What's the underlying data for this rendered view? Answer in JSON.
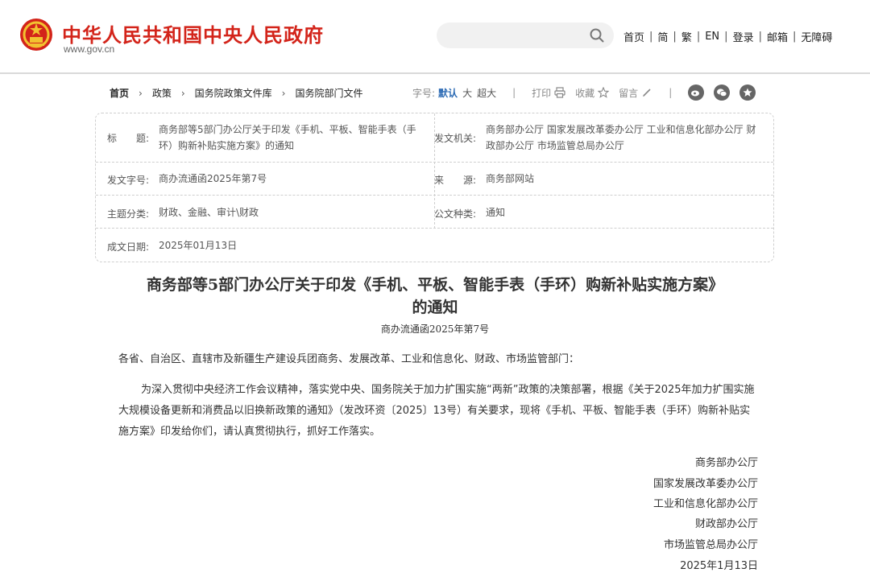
{
  "header": {
    "site_name": "中华人民共和国中央人民政府",
    "site_url": "www.gov.cn",
    "search": {
      "placeholder": ""
    },
    "links": [
      "首页",
      "简",
      "繁",
      "EN",
      "登录",
      "邮箱",
      "无障碍"
    ],
    "separator": "|"
  },
  "breadcrumb": {
    "items": [
      "首页",
      "政策",
      "国务院政策文件库",
      "国务院部门文件"
    ],
    "arrow": "›"
  },
  "toolbar": {
    "font_size_label": "字号:",
    "font_sizes": [
      "默认",
      "大",
      "超大"
    ],
    "print_label": "打印",
    "favorite_label": "收藏",
    "comment_label": "留言",
    "divider": "|"
  },
  "meta": {
    "title_label": "标　　题:",
    "title_value": "商务部等5部门办公厅关于印发《手机、平板、智能手表（手环）购新补贴实施方案》的通知",
    "issuer_label": "发文机关:",
    "issuer_value": "商务部办公厅  国家发展改革委办公厅  工业和信息化部办公厅  财政部办公厅  市场监管总局办公厅",
    "docno_label": "发文字号:",
    "docno_value": "商办流通函2025年第7号",
    "source_label": "来　　源:",
    "source_value": "商务部网站",
    "topic_label": "主题分类:",
    "topic_value": "财政、金融、审计\\财政",
    "kind_label": "公文种类:",
    "kind_value": "通知",
    "date_label": "成文日期:",
    "date_value": "2025年01月13日"
  },
  "article": {
    "title_line1": "商务部等5部门办公厅关于印发《手机、平板、智能手表（手环）购新补贴实施方案》",
    "title_line2": "的通知",
    "doc_number": "商办流通函2025年第7号",
    "salutation": "各省、自治区、直辖市及新疆生产建设兵团商务、发展改革、工业和信息化、财政、市场监管部门：",
    "body": "为深入贯彻中央经济工作会议精神，落实党中央、国务院关于加力扩围实施“两新”政策的决策部署，根据《关于2025年加力扩围实施大规模设备更新和消费品以旧换新政策的通知》（发改环资〔2025〕13号）有关要求，现将《手机、平板、智能手表（手环）购新补贴实施方案》印发给你们，请认真贯彻执行，抓好工作落实。",
    "signatories": [
      "商务部办公厅",
      "国家发展改革委办公厅",
      "工业和信息化部办公厅",
      "财政部办公厅",
      "市场监管总局办公厅"
    ],
    "sign_date": "2025年1月13日"
  },
  "colors": {
    "brand_red": "#d3241a",
    "link_blue": "#2d6bb4"
  },
  "icons": [
    "national-emblem-icon",
    "search-icon",
    "printer-icon",
    "star-icon",
    "pencil-icon",
    "weibo-icon",
    "wechat-icon",
    "favorites-icon"
  ]
}
